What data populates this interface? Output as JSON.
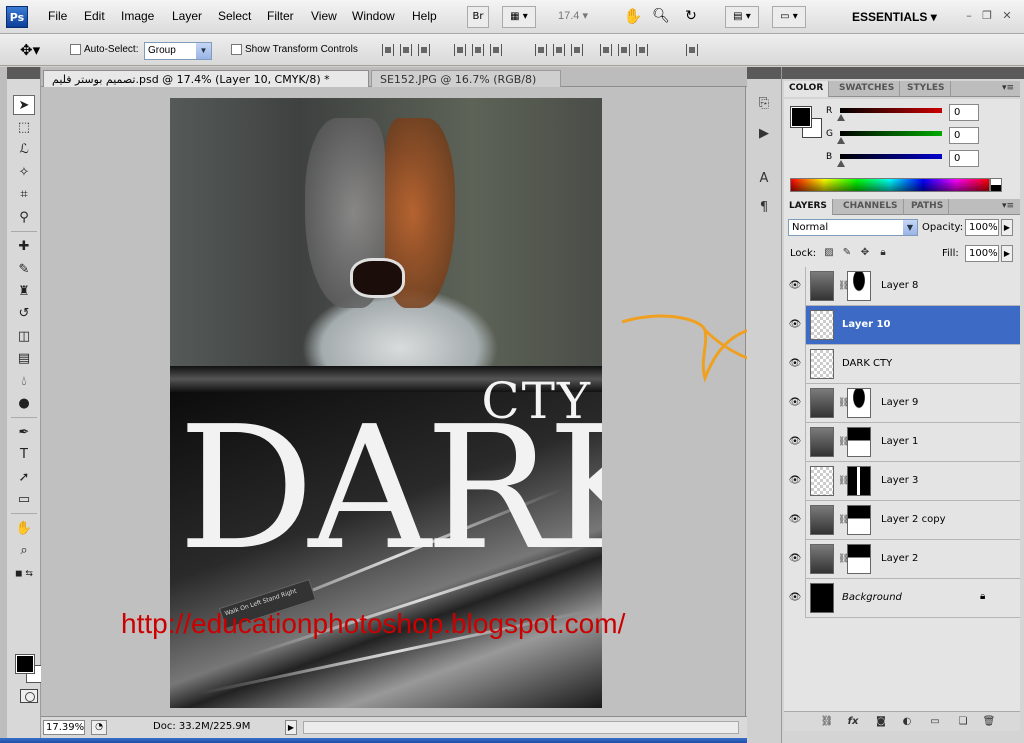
{
  "app": {
    "logo": "Ps"
  },
  "menu": [
    "File",
    "Edit",
    "Image",
    "Layer",
    "Select",
    "Filter",
    "View",
    "Window",
    "Help"
  ],
  "menubar": {
    "br_button": "Br",
    "zoom": "17.4",
    "workspace": "ESSENTIALS",
    "icons": [
      "bridge-icon",
      "view-extras-icon",
      "hand-icon",
      "zoom-icon",
      "rotate-view-icon",
      "arrange-documents-icon",
      "screen-mode-icon"
    ]
  },
  "options": {
    "auto_select_label": "Auto-Select:",
    "auto_select_checked": false,
    "auto_select_value": "Group",
    "show_transform_label": "Show Transform Controls",
    "show_transform_checked": false
  },
  "tabs": [
    {
      "label": "تصميم بوستر فليم.psd @ 17.4% (Layer 10, CMYK/8) *",
      "active": true
    },
    {
      "label": "SE152.JPG @ 16.7% (RGB/8)",
      "active": false
    }
  ],
  "canvas": {
    "poster_title_small": "CTY",
    "poster_title_large": "DARK",
    "poster_sign": "Walk On Left   Stand Right",
    "watermark_url": "http://educationphotoshop.blogspot.com/",
    "accent_arrow_color": "#f0a020",
    "url_color": "#cc0000"
  },
  "status": {
    "zoom": "17.39%",
    "doc_size": "Doc: 33.2M/225.9M"
  },
  "panels": {
    "color": {
      "tabs": [
        "COLOR",
        "SWATCHES",
        "STYLES"
      ],
      "active_tab": "COLOR",
      "r_label": "R",
      "g_label": "G",
      "b_label": "B",
      "r": "0",
      "g": "0",
      "b": "0",
      "r_color": "#cc0000",
      "g_color": "#00aa00",
      "b_color": "#0000cc"
    },
    "layers": {
      "tabs": [
        "LAYERS",
        "CHANNELS",
        "PATHS"
      ],
      "active_tab": "LAYERS",
      "blend_mode": "Normal",
      "opacity_label": "Opacity:",
      "opacity": "100%",
      "lock_label": "Lock:",
      "fill_label": "Fill:",
      "fill": "100%",
      "selected_color": "#3d6ac5",
      "rows": [
        {
          "name": "Layer 8",
          "visible": true,
          "thumb": "photo",
          "mask": "alt",
          "selected": false
        },
        {
          "name": "Layer 10",
          "visible": true,
          "thumb": "transparent",
          "mask": "",
          "selected": true
        },
        {
          "name": "DARK  CTY",
          "visible": true,
          "thumb": "transparent",
          "mask": "",
          "selected": false
        },
        {
          "name": "Layer 9",
          "visible": true,
          "thumb": "photo",
          "mask": "alt",
          "selected": false
        },
        {
          "name": "Layer 1",
          "visible": true,
          "thumb": "photo",
          "mask": "plain",
          "selected": false
        },
        {
          "name": "Layer 3",
          "visible": true,
          "thumb": "transparent",
          "mask": "bar",
          "selected": false
        },
        {
          "name": "Layer 2 copy",
          "visible": true,
          "thumb": "photo",
          "mask": "plain",
          "selected": false
        },
        {
          "name": "Layer 2",
          "visible": true,
          "thumb": "photo",
          "mask": "plain",
          "selected": false
        },
        {
          "name": "Background",
          "visible": true,
          "thumb": "black",
          "mask": "",
          "selected": false,
          "locked": true
        }
      ]
    }
  }
}
